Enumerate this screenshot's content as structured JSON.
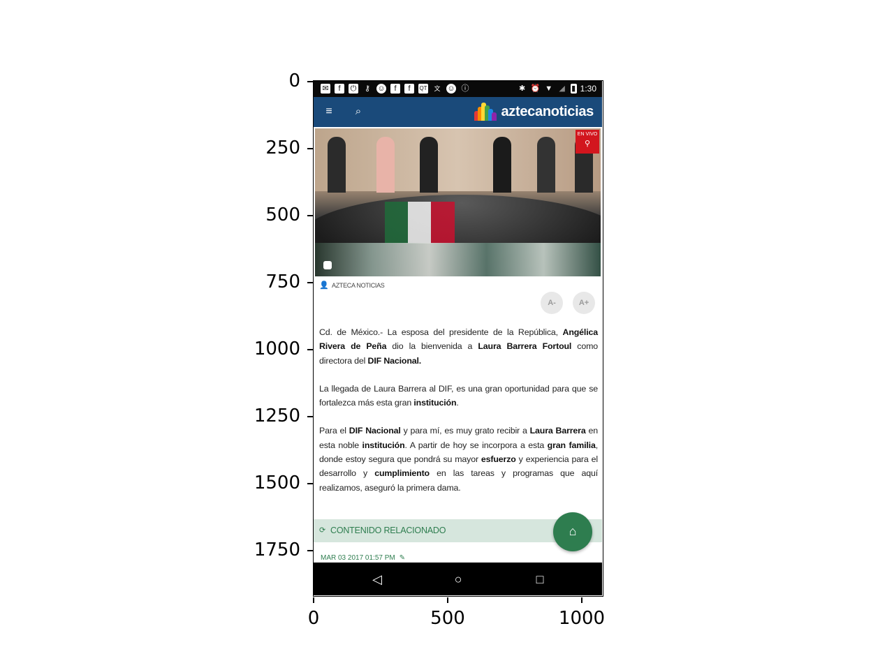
{
  "axis": {
    "y_ticks": [
      "0",
      "250",
      "500",
      "750",
      "1000",
      "1250",
      "1500",
      "1750"
    ],
    "x_ticks": [
      "0",
      "500",
      "1000"
    ]
  },
  "statusbar": {
    "time": "1:30",
    "left_icons": [
      "mail-icon",
      "facebook-icon",
      "power-icon",
      "key-icon",
      "smiley-icon",
      "facebook-icon",
      "facebook-icon",
      "qt-icon",
      "translate-icon",
      "smiley-icon",
      "info-icon"
    ],
    "right_icons": [
      "bluetooth-icon",
      "alarm-icon",
      "wifi-icon",
      "no-signal-icon",
      "battery-icon"
    ]
  },
  "appbar": {
    "menu_glyph": "≡",
    "search_glyph": "⌕",
    "logo_text": "aztecanoticias",
    "logo_colors": [
      "#e53935",
      "#fb8c00",
      "#fdd835",
      "#43a047",
      "#1e88e5",
      "#8e24aa"
    ]
  },
  "hero": {
    "live_label": "EN VIVO",
    "live_glyph": "⚲"
  },
  "byline": {
    "author": "AZTECA NOTICIAS"
  },
  "font_controls": {
    "decrease": "A-",
    "increase": "A+"
  },
  "article": {
    "p1_a": "Cd. de México.- La esposa del presidente de la República, ",
    "p1_b": "Angélica Rivera de Peña",
    "p1_c": " dio la bienvenida a ",
    "p1_d": "Laura Barrera Fortoul",
    "p1_e": " como directora del ",
    "p1_f": "DIF Nacional.",
    "p2_a": "La llegada de Laura Barrera al DIF, es una gran oportunidad para que se fortalezca más esta gran ",
    "p2_b": "institución",
    "p2_c": ".",
    "p3_a": "Para el ",
    "p3_b": "DIF Nacional",
    "p3_c": " y para mí, es muy grato recibir a ",
    "p3_d": "Laura Barrera",
    "p3_e": " en esta noble ",
    "p3_f": "institución",
    "p3_g": ". A partir de hoy se incorpora a esta ",
    "p3_h": "gran familia",
    "p3_i": ", donde estoy segura que pondrá su mayor ",
    "p3_j": "esfuerzo",
    "p3_k": " y experiencia para el desarrollo y ",
    "p3_l": "cumplimiento",
    "p3_m": " en las tareas y programas que aquí realizamos, aseguró la primera dama."
  },
  "related": {
    "label": "CONTENIDO RELACIONADO"
  },
  "date_line": {
    "text": "MAR 03 2017 01:57 PM"
  },
  "navbar": {
    "back": "◁",
    "home": "○",
    "recents": "□"
  },
  "colors": {
    "appbar": "#1a4a7a",
    "accent_green": "#2e7d4f",
    "live_red": "#d2161e"
  }
}
